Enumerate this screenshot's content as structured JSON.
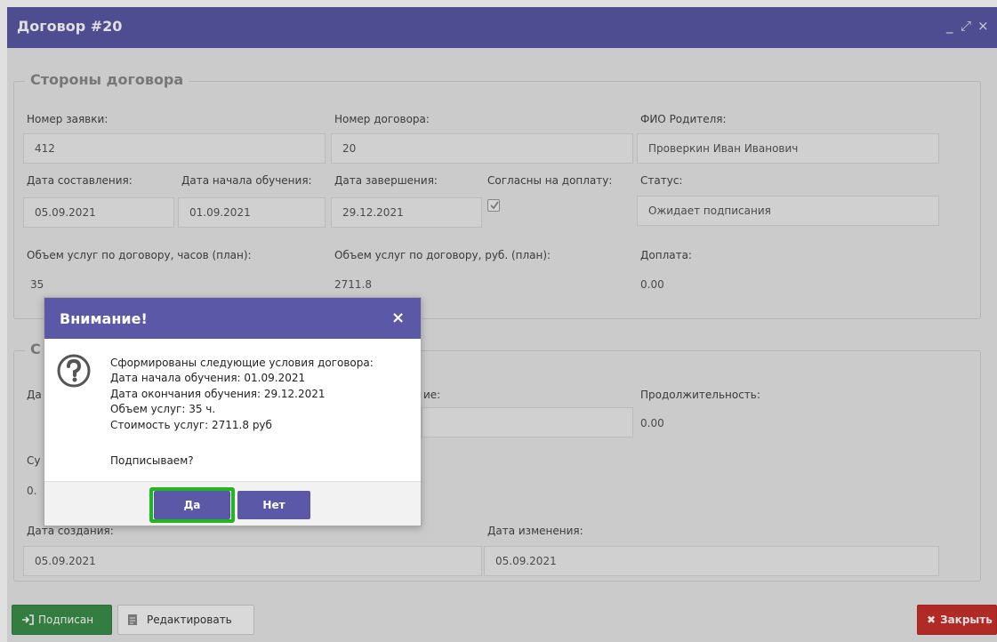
{
  "window": {
    "title": "Договор #20",
    "controls": {
      "minimize": "_",
      "maximize": "⤢",
      "close": "×"
    }
  },
  "parties": {
    "legend": "Стороны договора",
    "request_number": {
      "label": "Номер заявки:",
      "value": "412"
    },
    "contract_number": {
      "label": "Номер договора:",
      "value": "20"
    },
    "parent_name": {
      "label": "ФИО Родителя:",
      "value": "Проверкин Иван Иванович"
    },
    "date_created": {
      "label": "Дата составления:",
      "value": "05.09.2021"
    },
    "date_start": {
      "label": "Дата начала обучения:",
      "value": "01.09.2021"
    },
    "date_end": {
      "label": "Дата завершения:",
      "value": "29.12.2021"
    },
    "agree_surcharge": {
      "label": "Согласны на доплату:",
      "checked": true
    },
    "status": {
      "label": "Статус:",
      "value": "Ожидает подписания"
    },
    "hours_plan": {
      "label": "Объем услуг по договору, часов (план):",
      "value": "35"
    },
    "rub_plan": {
      "label": "Объем услуг по договору, руб. (план):",
      "value": "2711.8"
    },
    "surcharge": {
      "label": "Доплата:",
      "value": "0.00"
    }
  },
  "second": {
    "legend_fragment": "С",
    "label_da": "Да",
    "label_ie": "ие:",
    "duration": {
      "label": "Продолжительность:",
      "value": "0.00"
    },
    "label_su": "Су",
    "value_fragment": "0."
  },
  "meta": {
    "created": {
      "label": "Дата создания:",
      "value": "05.09.2021"
    },
    "modified": {
      "label": "Дата изменения:",
      "value": "05.09.2021"
    }
  },
  "footer": {
    "signed_label": "Подписан",
    "edit_label": "Редактировать",
    "close_label": "Закрыть"
  },
  "dialog": {
    "title": "Внимание!",
    "close": "×",
    "lines": [
      "Сформированы следующие условия договора:",
      "Дата начала обучения: 01.09.2021",
      "Дата окончания обучения: 29.12.2021",
      "Объем услуг: 35 ч.",
      "Стоимость услуг: 2711.8 руб"
    ],
    "question": "Подписываем?",
    "yes_label": "Да",
    "no_label": "Нет"
  },
  "colors": {
    "header": "#5a58a7",
    "success": "#3c8f49",
    "danger": "#c9302c",
    "focus": "#22b622"
  }
}
